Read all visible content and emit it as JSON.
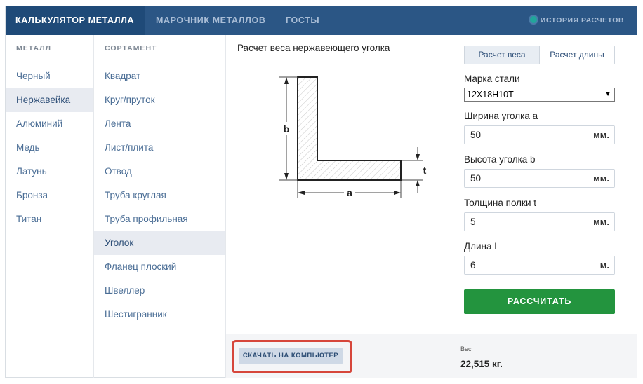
{
  "nav": {
    "tabs": [
      "КАЛЬКУЛЯТОР МЕТАЛЛА",
      "МАРОЧНИК МЕТАЛЛОВ",
      "ГОСТЫ"
    ],
    "history": "ИСТОРИЯ РАСЧЕТОВ"
  },
  "metals": {
    "header": "МЕТАЛЛ",
    "items": [
      "Черный",
      "Нержавейка",
      "Алюминий",
      "Медь",
      "Латунь",
      "Бронза",
      "Титан"
    ]
  },
  "assortment": {
    "header": "СОРТАМЕНТ",
    "items": [
      "Квадрат",
      "Круг/пруток",
      "Лента",
      "Лист/плита",
      "Отвод",
      "Труба круглая",
      "Труба профильная",
      "Уголок",
      "Фланец плоский",
      "Швеллер",
      "Шестигранник"
    ]
  },
  "calc": {
    "title": "Расчет веса нержавеющего уголка",
    "mode_tabs": [
      "Расчет веса",
      "Расчет длины"
    ],
    "drawing": {
      "label_a": "a",
      "label_b": "b",
      "label_t": "t"
    },
    "steel": {
      "label": "Марка стали",
      "value": "12Х18Н10Т"
    },
    "width": {
      "label": "Ширина уголка a",
      "value": "50",
      "unit": "мм."
    },
    "height": {
      "label": "Высота уголка b",
      "value": "50",
      "unit": "мм."
    },
    "thickness": {
      "label": "Толщина полки t",
      "value": "5",
      "unit": "мм."
    },
    "length": {
      "label": "Длина L",
      "value": "6",
      "unit": "м."
    },
    "button": "РАССЧИТАТЬ"
  },
  "footer": {
    "download": "СКАЧАТЬ НА КОМПЬЮТЕР",
    "weight_label": "Вес",
    "weight_value": "22,515 кг."
  },
  "colors": {
    "nav_bg": "#2b5685",
    "nav_active": "#1f4a78",
    "accent_green": "#23943e",
    "highlight": "#d6463b",
    "link": "#4a6d95"
  }
}
